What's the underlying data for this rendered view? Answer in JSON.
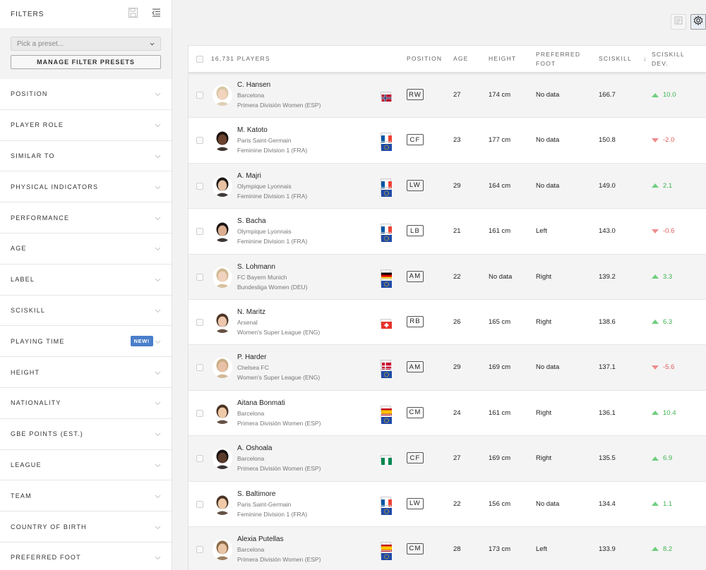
{
  "sidebar": {
    "title": "FILTERS",
    "preset_placeholder": "Pick a preset...",
    "manage_presets_label": "MANAGE FILTER PRESETS",
    "filters": [
      {
        "label": "POSITION"
      },
      {
        "label": "PLAYER ROLE"
      },
      {
        "label": "SIMILAR TO"
      },
      {
        "label": "PHYSICAL INDICATORS"
      },
      {
        "label": "PERFORMANCE"
      },
      {
        "label": "AGE"
      },
      {
        "label": "LABEL"
      },
      {
        "label": "SCISKILL"
      },
      {
        "label": "PLAYING TIME",
        "badge": "NEW!"
      },
      {
        "label": "HEIGHT"
      },
      {
        "label": "NATIONALITY"
      },
      {
        "label": "GBE POINTS (EST.)"
      },
      {
        "label": "LEAGUE"
      },
      {
        "label": "TEAM"
      },
      {
        "label": "COUNTRY OF BIRTH"
      },
      {
        "label": "PREFERRED FOOT"
      }
    ]
  },
  "table": {
    "headers": {
      "players": "16,731 PLAYERS",
      "position": "POSITION",
      "age": "AGE",
      "height": "HEIGHT",
      "foot_line1": "PREFERRED",
      "foot_line2": "FOOT",
      "sciskill": "SCISKILL",
      "sort_icon": "↓",
      "dev_line1": "SCISKILL",
      "dev_line2": "DEV."
    },
    "rows": [
      {
        "name": "C. Hansen",
        "club": "Barcelona",
        "league": "Primera División Women (ESP)",
        "flags": [
          "norway"
        ],
        "position": "RW",
        "age": "27",
        "height": "174 cm",
        "foot": "No data",
        "sciskill": "166.7",
        "dev": "10.0",
        "dev_dir": "up",
        "skin": "#f2d3bd",
        "hair": "#d9c8a8"
      },
      {
        "name": "M. Katoto",
        "club": "Paris Saint-Germain",
        "league": "Feminine Division 1 (FRA)",
        "flags": [
          "france",
          "eu"
        ],
        "position": "CF",
        "age": "23",
        "height": "177 cm",
        "foot": "No data",
        "sciskill": "150.8",
        "dev": "-2.0",
        "dev_dir": "down",
        "skin": "#6b4330",
        "hair": "#1c120d"
      },
      {
        "name": "A. Majri",
        "club": "Olympique Lyonnais",
        "league": "Feminine Division 1 (FRA)",
        "flags": [
          "france",
          "eu"
        ],
        "position": "LW",
        "age": "29",
        "height": "164 cm",
        "foot": "No data",
        "sciskill": "149.0",
        "dev": "2.1",
        "dev_dir": "up",
        "skin": "#e8c2a4",
        "hair": "#1e1714"
      },
      {
        "name": "S. Bacha",
        "club": "Olympique Lyonnais",
        "league": "Feminine Division 1 (FRA)",
        "flags": [
          "france",
          "eu"
        ],
        "position": "LB",
        "age": "21",
        "height": "161 cm",
        "foot": "Left",
        "sciskill": "143.0",
        "dev": "-0.6",
        "dev_dir": "down",
        "skin": "#dcae8f",
        "hair": "#1a1411"
      },
      {
        "name": "S. Lohmann",
        "club": "FC Bayern Munich",
        "league": "Bundesliga Women (DEU)",
        "flags": [
          "germany",
          "eu"
        ],
        "position": "AM",
        "age": "22",
        "height": "No data",
        "foot": "Right",
        "sciskill": "139.2",
        "dev": "3.3",
        "dev_dir": "up",
        "skin": "#f1d2bf",
        "hair": "#cfb88f"
      },
      {
        "name": "N. Maritz",
        "club": "Arsenal",
        "league": "Women's Super League (ENG)",
        "flags": [
          "switzerland"
        ],
        "position": "RB",
        "age": "26",
        "height": "165 cm",
        "foot": "Right",
        "sciskill": "138.6",
        "dev": "6.3",
        "dev_dir": "up",
        "skin": "#ecc6ad",
        "hair": "#4a3323"
      },
      {
        "name": "P. Harder",
        "club": "Chelsea FC",
        "league": "Women's Super League (ENG)",
        "flags": [
          "denmark",
          "eu"
        ],
        "position": "AM",
        "age": "29",
        "height": "169 cm",
        "foot": "No data",
        "sciskill": "137.1",
        "dev": "-5.6",
        "dev_dir": "down",
        "skin": "#e7c0a6",
        "hair": "#c9ad85"
      },
      {
        "name": "Aitana Bonmati",
        "club": "Barcelona",
        "league": "Primera División Women (ESP)",
        "flags": [
          "spain",
          "eu"
        ],
        "position": "CM",
        "age": "24",
        "height": "161 cm",
        "foot": "Right",
        "sciskill": "136.1",
        "dev": "10.4",
        "dev_dir": "up",
        "skin": "#f0caa8",
        "hair": "#4a3324"
      },
      {
        "name": "A. Oshoala",
        "club": "Barcelona",
        "league": "Primera División Women (ESP)",
        "flags": [
          "nigeria"
        ],
        "position": "CF",
        "age": "27",
        "height": "169 cm",
        "foot": "Right",
        "sciskill": "135.5",
        "dev": "6.9",
        "dev_dir": "up",
        "skin": "#5a3a2a",
        "hair": "#171010"
      },
      {
        "name": "S. Baltimore",
        "club": "Paris Saint-Germain",
        "league": "Feminine Division 1 (FRA)",
        "flags": [
          "france",
          "eu"
        ],
        "position": "LW",
        "age": "22",
        "height": "156 cm",
        "foot": "No data",
        "sciskill": "134.4",
        "dev": "1.1",
        "dev_dir": "up",
        "skin": "#f0caa8",
        "hair": "#4a3324"
      },
      {
        "name": "Alexia Putellas",
        "club": "Barcelona",
        "league": "Primera División Women (ESP)",
        "flags": [
          "spain",
          "eu"
        ],
        "position": "CM",
        "age": "28",
        "height": "173 cm",
        "foot": "Left",
        "sciskill": "133.9",
        "dev": "8.2",
        "dev_dir": "up",
        "skin": "#e9c4a6",
        "hair": "#8a6a45"
      }
    ]
  },
  "colors": {
    "accent_badge": "#4a7ec9",
    "dev_up": "#3fb452",
    "dev_down": "#e05b5b"
  }
}
